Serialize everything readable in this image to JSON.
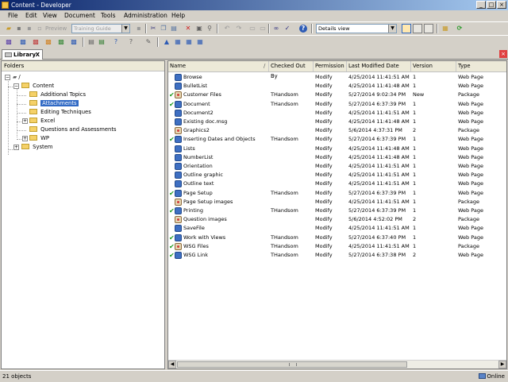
{
  "window": {
    "title": "Content - Developer"
  },
  "menu": [
    "File",
    "Edit",
    "View",
    "Document",
    "Tools",
    "Administration",
    "Help"
  ],
  "toolbar": {
    "preview_label": "Preview",
    "guide_combo": "Training Guide",
    "view_combo": "Details view"
  },
  "tab": {
    "label": "Library",
    "close": "X"
  },
  "folders": {
    "header": "Folders",
    "nodes": [
      {
        "label": "/",
        "depth": 0
      },
      {
        "label": "Content",
        "depth": 1
      },
      {
        "label": "Additional Topics",
        "depth": 2
      },
      {
        "label": "Attachments",
        "depth": 2,
        "selected": true
      },
      {
        "label": "Editing Techniques",
        "depth": 2
      },
      {
        "label": "Excel",
        "depth": 2
      },
      {
        "label": "Questions and Assessments",
        "depth": 2
      },
      {
        "label": "WP",
        "depth": 2
      },
      {
        "label": "System",
        "depth": 1
      }
    ]
  },
  "columns": {
    "name": "Name",
    "checked_out_by": "Checked Out By",
    "permission": "Permission",
    "last_modified": "Last Modified Date",
    "version": "Version",
    "type": "Type"
  },
  "rows": [
    {
      "check": false,
      "icon": "page",
      "name": "Browse",
      "checked_out_by": "",
      "permission": "Modify",
      "modified": "4/25/2014 11:41:51 AM",
      "version": "1",
      "type": "Web Page"
    },
    {
      "check": false,
      "icon": "page",
      "name": "BulletList",
      "checked_out_by": "",
      "permission": "Modify",
      "modified": "4/25/2014 11:41:48 AM",
      "version": "1",
      "type": "Web Page"
    },
    {
      "check": true,
      "icon": "package",
      "name": "Customer Files",
      "checked_out_by": "THandsom",
      "permission": "Modify",
      "modified": "5/27/2014 9:02:34 PM",
      "version": "New",
      "type": "Package"
    },
    {
      "check": true,
      "icon": "page",
      "name": "Document",
      "checked_out_by": "THandsom",
      "permission": "Modify",
      "modified": "5/27/2014 6:37:39 PM",
      "version": "1",
      "type": "Web Page"
    },
    {
      "check": false,
      "icon": "page",
      "name": "Document2",
      "checked_out_by": "",
      "permission": "Modify",
      "modified": "4/25/2014 11:41:51 AM",
      "version": "1",
      "type": "Web Page"
    },
    {
      "check": false,
      "icon": "page",
      "name": "Existing doc.msg",
      "checked_out_by": "",
      "permission": "Modify",
      "modified": "4/25/2014 11:41:48 AM",
      "version": "1",
      "type": "Web Page"
    },
    {
      "check": false,
      "icon": "package",
      "name": "Graphics2",
      "checked_out_by": "",
      "permission": "Modify",
      "modified": "5/6/2014 4:37:31 PM",
      "version": "2",
      "type": "Package"
    },
    {
      "check": true,
      "icon": "page",
      "name": "Inserting Dates and Objects",
      "checked_out_by": "THandsom",
      "permission": "Modify",
      "modified": "5/27/2014 6:37:39 PM",
      "version": "1",
      "type": "Web Page"
    },
    {
      "check": false,
      "icon": "page",
      "name": "Lists",
      "checked_out_by": "",
      "permission": "Modify",
      "modified": "4/25/2014 11:41:48 AM",
      "version": "1",
      "type": "Web Page"
    },
    {
      "check": false,
      "icon": "page",
      "name": "NumberList",
      "checked_out_by": "",
      "permission": "Modify",
      "modified": "4/25/2014 11:41:48 AM",
      "version": "1",
      "type": "Web Page"
    },
    {
      "check": false,
      "icon": "page",
      "name": "Orientation",
      "checked_out_by": "",
      "permission": "Modify",
      "modified": "4/25/2014 11:41:51 AM",
      "version": "1",
      "type": "Web Page"
    },
    {
      "check": false,
      "icon": "page",
      "name": "Outline graphic",
      "checked_out_by": "",
      "permission": "Modify",
      "modified": "4/25/2014 11:41:51 AM",
      "version": "1",
      "type": "Web Page"
    },
    {
      "check": false,
      "icon": "page",
      "name": "Outline text",
      "checked_out_by": "",
      "permission": "Modify",
      "modified": "4/25/2014 11:41:51 AM",
      "version": "1",
      "type": "Web Page"
    },
    {
      "check": true,
      "icon": "page",
      "name": "Page Setup",
      "checked_out_by": "THandsom",
      "permission": "Modify",
      "modified": "5/27/2014 6:37:39 PM",
      "version": "1",
      "type": "Web Page"
    },
    {
      "check": false,
      "icon": "package",
      "name": "Page Setup images",
      "checked_out_by": "",
      "permission": "Modify",
      "modified": "4/25/2014 11:41:51 AM",
      "version": "1",
      "type": "Package"
    },
    {
      "check": true,
      "icon": "page",
      "name": "Printing",
      "checked_out_by": "THandsom",
      "permission": "Modify",
      "modified": "5/27/2014 6:37:39 PM",
      "version": "1",
      "type": "Web Page"
    },
    {
      "check": false,
      "icon": "package",
      "name": "Question images",
      "checked_out_by": "",
      "permission": "Modify",
      "modified": "5/6/2014 4:52:02 PM",
      "version": "2",
      "type": "Package"
    },
    {
      "check": false,
      "icon": "page",
      "name": "SaveFile",
      "checked_out_by": "",
      "permission": "Modify",
      "modified": "4/25/2014 11:41:51 AM",
      "version": "1",
      "type": "Web Page"
    },
    {
      "check": true,
      "icon": "page",
      "name": "Work with Views",
      "checked_out_by": "THandsom",
      "permission": "Modify",
      "modified": "5/27/2014 6:37:40 PM",
      "version": "1",
      "type": "Web Page"
    },
    {
      "check": true,
      "icon": "package",
      "name": "WSG Files",
      "checked_out_by": "THandsom",
      "permission": "Modify",
      "modified": "4/25/2014 11:41:51 AM",
      "version": "1",
      "type": "Package"
    },
    {
      "check": true,
      "icon": "page",
      "name": "WSG Link",
      "checked_out_by": "THandsom",
      "permission": "Modify",
      "modified": "5/27/2014 6:37:38 PM",
      "version": "2",
      "type": "Web Page"
    }
  ],
  "status": {
    "left": "21 objects",
    "right": "Online"
  }
}
